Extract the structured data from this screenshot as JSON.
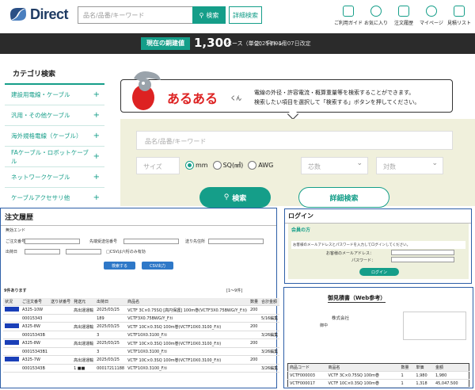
{
  "header": {
    "logo_text": "Direct",
    "search_placeholder": "品名/品番/キーワード",
    "search_button": "検索",
    "detail_button": "詳細検索",
    "nav": [
      {
        "label": "ご利用ガイド",
        "icon": "book-icon"
      },
      {
        "label": "お気に入り",
        "icon": "heart-icon"
      },
      {
        "label": "注文履歴",
        "icon": "history-icon"
      },
      {
        "label": "マイページ",
        "icon": "user-icon"
      },
      {
        "label": "見積リスト",
        "icon": "document-icon"
      }
    ]
  },
  "price_bar": {
    "label": "現在の銅建値",
    "value": "1,300",
    "unit": "ベース（単位：千/トン）",
    "note": "2025年04月07日改定"
  },
  "sidebar": {
    "title": "カテゴリ検索",
    "items": [
      "建設用電線・ケーブル",
      "汎用・その他ケーブル",
      "海外規格電線（ケーブル）",
      "FAケーブル・ロボットケーブル",
      "ネットワークケーブル",
      "ケーブルアクセサリ他"
    ]
  },
  "banner": {
    "title": "あるある",
    "suffix": "くん",
    "line1": "電線の外径・許容電流・概算重量等を検索することができます。",
    "line2": "検索したい項目を選択して「検索する」ボタンを押してください。"
  },
  "search_panel": {
    "keyword_placeholder": "品名/品番/キーワード",
    "size_placeholder": "サイズ",
    "units": [
      "mm",
      "SQ(㎟)",
      "AWG"
    ],
    "selected_unit": "mm",
    "cores_placeholder": "芯数",
    "pairs_placeholder": "対数",
    "search_button": "検索",
    "detail_button": "詳細検索"
  },
  "order_history": {
    "title": "注文履歴",
    "sub": "無効エンド",
    "fields": [
      "ご注文番号",
      "先端受送信番号",
      "送り先住所",
      "出荷日"
    ],
    "csv_note": "□CSVは六桁のみ有効",
    "btn_search": "検索する",
    "btn_csv": "CSV出力",
    "count_text": "9件あります",
    "pager": "[1〜9件]",
    "columns": [
      "状況",
      "ご注文番号",
      "送り状番号",
      "発送元",
      "出荷日",
      "商品名",
      "数量",
      "合計金額"
    ],
    "rows": [
      [
        "",
        "A325-10W",
        "",
        "高出運運輸",
        "2025/03/25",
        "VCTF 3C×0.75SQ [高円保護] 100m巻(VCTF3X0.75BWG/Y_F.ti)",
        "200",
        ""
      ],
      [
        "",
        "00015343",
        "",
        "",
        "189",
        "VCTF3X0.75BWG/Y_F.ti",
        "",
        "5/16編集"
      ],
      [
        "",
        "A325-8W",
        "",
        "高出運運輸",
        "2025/03/25",
        "VCTF 10C×0.3SQ 100m巻(VCTF10X0.3100_F.ti)",
        "200",
        ""
      ],
      [
        "",
        "00015343B",
        "",
        "",
        "3",
        "VCTF10X0.3100_F.ti",
        "",
        "3/26編集"
      ],
      [
        "",
        "A325-8W",
        "",
        "高出運運輸",
        "2025/03/25",
        "VCTF 10C×0.3SQ 100m巻(VCTF10X0.3100_F.ti)",
        "200",
        ""
      ],
      [
        "",
        "00015343B1",
        "",
        "",
        "3",
        "VCTF10X0.3100_F.ti",
        "",
        "3/26編集"
      ],
      [
        "",
        "A325-7W",
        "",
        "高出運運輸",
        "2025/03/25",
        "VCTF 10C×0.3SQ 100m巻(VCTF10X0.3100_F.ti)",
        "200",
        ""
      ],
      [
        "",
        "00015343B",
        "",
        "1 ■■",
        "00017211188",
        "VCTF10X0.3100_F.ti",
        "",
        "3/26編集"
      ]
    ]
  },
  "login": {
    "title": "ログイン",
    "section": "会員の方",
    "note": "お客様のメールアドレスとパスワードを入力してログインしてください。",
    "email_label": "お客様のメールアドレス：",
    "password_label": "パスワード：",
    "button": "ログイン"
  },
  "quote": {
    "title": "御見積書（Web参考）",
    "company": "株式会社",
    "to": "御中",
    "columns": [
      "商品コード",
      "商品名",
      "数量",
      "単価",
      "金額"
    ],
    "rows": [
      [
        "VCTF000003",
        "VCTF 3C×0.75SQ 100m巻",
        "1",
        "1,980",
        "1,980"
      ],
      [
        "VCTF000017",
        "VCTF 10C×0.3SQ 100m巻",
        "1",
        "1,318",
        "45,047.500"
      ]
    ]
  }
}
